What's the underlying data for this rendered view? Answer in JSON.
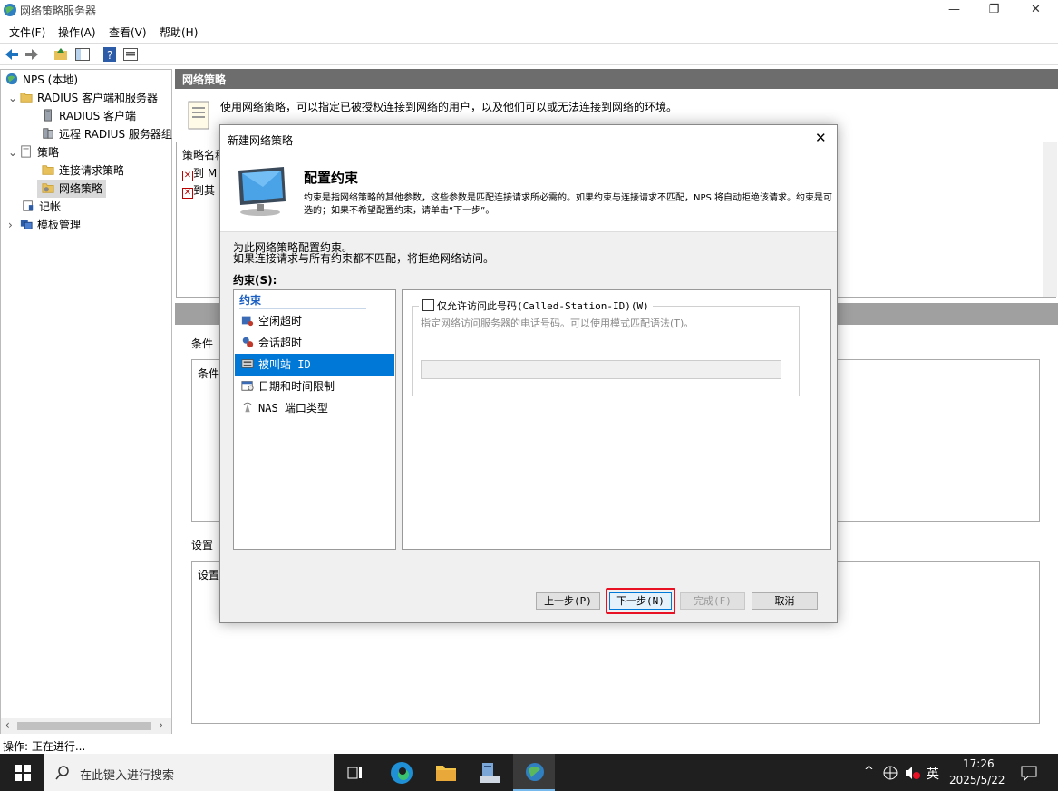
{
  "window": {
    "title": "网络策略服务器",
    "minimize_glyph": "—",
    "maximize_glyph": "❐",
    "close_glyph": "✕"
  },
  "menubar": {
    "items": [
      "文件(F)",
      "操作(A)",
      "查看(V)",
      "帮助(H)"
    ]
  },
  "tree": {
    "items": [
      {
        "label": "NPS (本地)",
        "icon": "globe-icon"
      },
      {
        "label": "RADIUS 客户端和服务器",
        "icon": "folder-icon",
        "expander": "⌄"
      },
      {
        "label": "RADIUS 客户端",
        "icon": "server-icon"
      },
      {
        "label": "远程 RADIUS 服务器组",
        "icon": "server-group-icon"
      },
      {
        "label": "策略",
        "icon": "policy-icon",
        "expander": "⌄"
      },
      {
        "label": "连接请求策略",
        "icon": "folder-icon"
      },
      {
        "label": "网络策略",
        "icon": "folder-open-icon"
      },
      {
        "label": "记帐",
        "icon": "accounting-icon"
      },
      {
        "label": "模板管理",
        "icon": "template-icon",
        "expander": "›"
      }
    ],
    "scroll_left": "‹",
    "scroll_right": "›"
  },
  "right": {
    "header": "网络策略",
    "description": "使用网络策略，可以指定已被授权连接到网络的用户，以及他们可以或无法连接到网络的环境。",
    "policy_name_col": "策略名称",
    "policies": [
      "到 M",
      "到其"
    ],
    "conditions_label": "条件",
    "conditions_box": "条件",
    "settings_label": "设置",
    "settings_box": "设置"
  },
  "statusbar": {
    "text": "操作: 正在进行..."
  },
  "dialog": {
    "title": "新建网络策略",
    "close_glyph": "✕",
    "heading": "配置约束",
    "description": "约束是指网络策略的其他参数，这些参数是匹配连接请求所必需的。如果约束与连接请求不匹配，NPS 将自动拒绝该请求。约束是可选的；如果不希望配置约束，请单击“下一步”。",
    "intro_line1": "为此网络策略配置约束。",
    "intro_line2": "如果连接请求与所有约束都不匹配，将拒绝网络访问。",
    "constraints_label": "约束(S):",
    "list_header": "约束",
    "list": [
      {
        "label": "空闲超时",
        "icon": "idle-timeout-icon"
      },
      {
        "label": "会话超时",
        "icon": "session-timeout-icon"
      },
      {
        "label": "被叫站 ID",
        "icon": "called-station-icon"
      },
      {
        "label": "日期和时间限制",
        "icon": "datetime-icon"
      },
      {
        "label": "NAS 端口类型",
        "icon": "nas-port-icon"
      }
    ],
    "selected_index": 2,
    "checkbox_label": "仅允许访问此号码(Called-Station-ID)(W)",
    "checkbox_checked": false,
    "help_text": "指定网络访问服务器的电话号码。可以使用模式匹配语法(T)。",
    "input_value": "",
    "buttons": {
      "back": "上一步(P)",
      "next": "下一步(N)",
      "finish": "完成(F)",
      "cancel": "取消"
    }
  },
  "taskbar": {
    "search_placeholder": "在此键入进行搜索",
    "ime": "英",
    "time": "17:26",
    "date": "2025/5/22",
    "tray_up": "^"
  },
  "colors": {
    "selection": "#0078d7",
    "highlight_border": "#e81123",
    "panel_header": "#6d6d6d",
    "taskbar": "#1f1f1f"
  }
}
